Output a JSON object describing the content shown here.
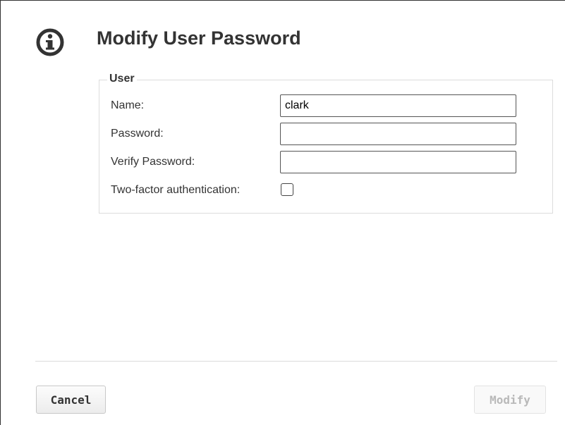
{
  "dialog": {
    "title": "Modify User Password",
    "icon": "info-icon"
  },
  "user_section": {
    "legend": "User",
    "name_label": "Name:",
    "name_value": "clark",
    "password_label": "Password:",
    "password_value": "",
    "verify_label": "Verify Password:",
    "verify_value": "",
    "two_factor_label": "Two-factor authentication:",
    "two_factor_checked": false
  },
  "buttons": {
    "cancel": "Cancel",
    "modify": "Modify",
    "modify_enabled": false
  }
}
